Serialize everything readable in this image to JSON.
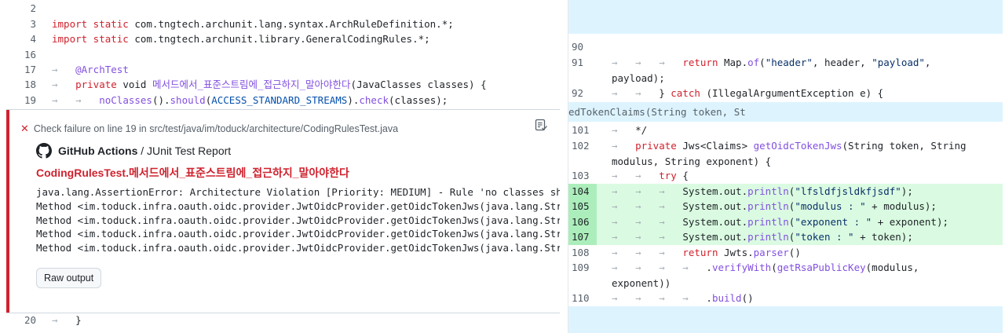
{
  "left": {
    "lines": [
      {
        "num": "2",
        "code": ""
      },
      {
        "num": "3",
        "parts": [
          [
            "kw",
            "import static "
          ],
          [
            "",
            "com.tngtech.archunit.lang.syntax.ArchRuleDefinition.*;"
          ]
        ]
      },
      {
        "num": "4",
        "parts": [
          [
            "kw",
            "import static "
          ],
          [
            "",
            "com.tngtech.archunit.library.GeneralCodingRules.*;"
          ]
        ]
      },
      {
        "num": "16",
        "code": ""
      },
      {
        "num": "17",
        "parts": [
          [
            "tab",
            "→   "
          ],
          [
            "an",
            "@ArchTest"
          ]
        ]
      },
      {
        "num": "18",
        "parts": [
          [
            "tab",
            "→   "
          ],
          [
            "kw",
            "private "
          ],
          [
            "",
            "void "
          ],
          [
            "fn",
            "메서드에서_표준스트림에_접근하지_말아야한다"
          ],
          [
            "",
            "(JavaClasses classes) {"
          ]
        ]
      },
      {
        "num": "19",
        "parts": [
          [
            "tab",
            "→   →   "
          ],
          [
            "fn",
            "noClasses"
          ],
          [
            "",
            "()."
          ],
          [
            "fn",
            "should"
          ],
          [
            "",
            "("
          ],
          [
            "const",
            "ACCESS_STANDARD_STREAMS"
          ],
          [
            "",
            ")."
          ],
          [
            "fn",
            "check"
          ],
          [
            "",
            "(classes);"
          ]
        ]
      },
      {
        "num": "20",
        "parts": [
          [
            "tab",
            "→   "
          ],
          [
            "",
            "}"
          ]
        ]
      }
    ],
    "annotation": {
      "icon": "x-icon",
      "header": "Check failure on line 19 in src/test/java/im/toduck/architecture/CodingRulesTest.java",
      "app_name": "GitHub Actions",
      "app_sep": " / ",
      "app_report": "JUnit Test Report",
      "title": "CodingRulesTest.메서드에서_표준스트림에_접근하지_말아야한다",
      "body": [
        "java.lang.AssertionError: Architecture Violation [Priority: MEDIUM] - Rule 'no classes should a",
        "Method <im.toduck.infra.oauth.oidc.provider.JwtOidcProvider.getOidcTokenJws(java.lang.String, j",
        "Method <im.toduck.infra.oauth.oidc.provider.JwtOidcProvider.getOidcTokenJws(java.lang.String, j",
        "Method <im.toduck.infra.oauth.oidc.provider.JwtOidcProvider.getOidcTokenJws(java.lang.String, j",
        "Method <im.toduck.infra.oauth.oidc.provider.JwtOidcProvider.getOidcTokenJws(java.lang.String, j"
      ],
      "raw_output_label": "Raw output"
    }
  },
  "right": {
    "hunk1": "",
    "hunk2": "edTokenClaims(String token, St",
    "lines": [
      {
        "num": "90",
        "parts": []
      },
      {
        "num": "91",
        "parts": [
          [
            "tab",
            "→   →   →   "
          ],
          [
            "kw",
            "return "
          ],
          [
            "",
            "Map."
          ],
          [
            "fn",
            "of"
          ],
          [
            "",
            "("
          ],
          [
            "str",
            "\"header\""
          ],
          [
            "",
            ", header, "
          ],
          [
            "str",
            "\"payload\""
          ],
          [
            "",
            ","
          ]
        ],
        "wrap": "payload);"
      },
      {
        "num": "92",
        "parts": [
          [
            "tab",
            "→   →   "
          ],
          [
            "",
            "} "
          ],
          [
            "kw",
            "catch "
          ],
          [
            "",
            "(IllegalArgumentException e) {"
          ]
        ]
      },
      {
        "num": "101",
        "parts": [
          [
            "tab",
            "→   "
          ],
          [
            "",
            "*/"
          ]
        ]
      },
      {
        "num": "102",
        "parts": [
          [
            "tab",
            "→   "
          ],
          [
            "kw",
            "private "
          ],
          [
            "",
            "Jws<Claims> "
          ],
          [
            "fn",
            "getOidcTokenJws"
          ],
          [
            "",
            "(String token, String"
          ]
        ],
        "wrap": "modulus, String exponent) {"
      },
      {
        "num": "103",
        "parts": [
          [
            "tab",
            "→   →   "
          ],
          [
            "kw",
            "try "
          ],
          [
            "",
            "{"
          ]
        ]
      },
      {
        "num": "104",
        "hl": true,
        "parts": [
          [
            "tab",
            "→   →   →   "
          ],
          [
            "",
            "System.out."
          ],
          [
            "fn",
            "println"
          ],
          [
            "",
            "("
          ],
          [
            "str",
            "\"lfsldfjsldkfjsdf\""
          ],
          [
            "",
            ");"
          ]
        ]
      },
      {
        "num": "105",
        "hl": true,
        "parts": [
          [
            "tab",
            "→   →   →   "
          ],
          [
            "",
            "System.out."
          ],
          [
            "fn",
            "println"
          ],
          [
            "",
            "("
          ],
          [
            "str",
            "\"modulus : \""
          ],
          [
            "",
            " + modulus);"
          ]
        ]
      },
      {
        "num": "106",
        "hl": true,
        "parts": [
          [
            "tab",
            "→   →   →   "
          ],
          [
            "",
            "System.out."
          ],
          [
            "fn",
            "println"
          ],
          [
            "",
            "("
          ],
          [
            "str",
            "\"exponent : \""
          ],
          [
            "",
            " + exponent);"
          ]
        ]
      },
      {
        "num": "107",
        "hl": true,
        "parts": [
          [
            "tab",
            "→   →   →   "
          ],
          [
            "",
            "System.out."
          ],
          [
            "fn",
            "println"
          ],
          [
            "",
            "("
          ],
          [
            "str",
            "\"token : \""
          ],
          [
            "",
            " + token);"
          ]
        ]
      },
      {
        "num": "108",
        "parts": [
          [
            "tab",
            "→   →   →   "
          ],
          [
            "kw",
            "return "
          ],
          [
            "",
            "Jwts."
          ],
          [
            "fn",
            "parser"
          ],
          [
            "",
            "()"
          ]
        ]
      },
      {
        "num": "109",
        "parts": [
          [
            "tab",
            "→   →   →   →   "
          ],
          [
            "",
            "."
          ],
          [
            "fn",
            "verifyWith"
          ],
          [
            "",
            "("
          ],
          [
            "fn",
            "getRsaPublicKey"
          ],
          [
            "",
            "(modulus,"
          ]
        ],
        "wrap": "exponent))"
      },
      {
        "num": "110",
        "parts": [
          [
            "tab",
            "→   →   →   →   "
          ],
          [
            "",
            "."
          ],
          [
            "fn",
            "build"
          ],
          [
            "",
            "()"
          ]
        ]
      }
    ]
  },
  "colors": {
    "accent_red": "#cf222e",
    "hunk_blue": "#ddf4ff",
    "add_green": "#dafbe1"
  }
}
